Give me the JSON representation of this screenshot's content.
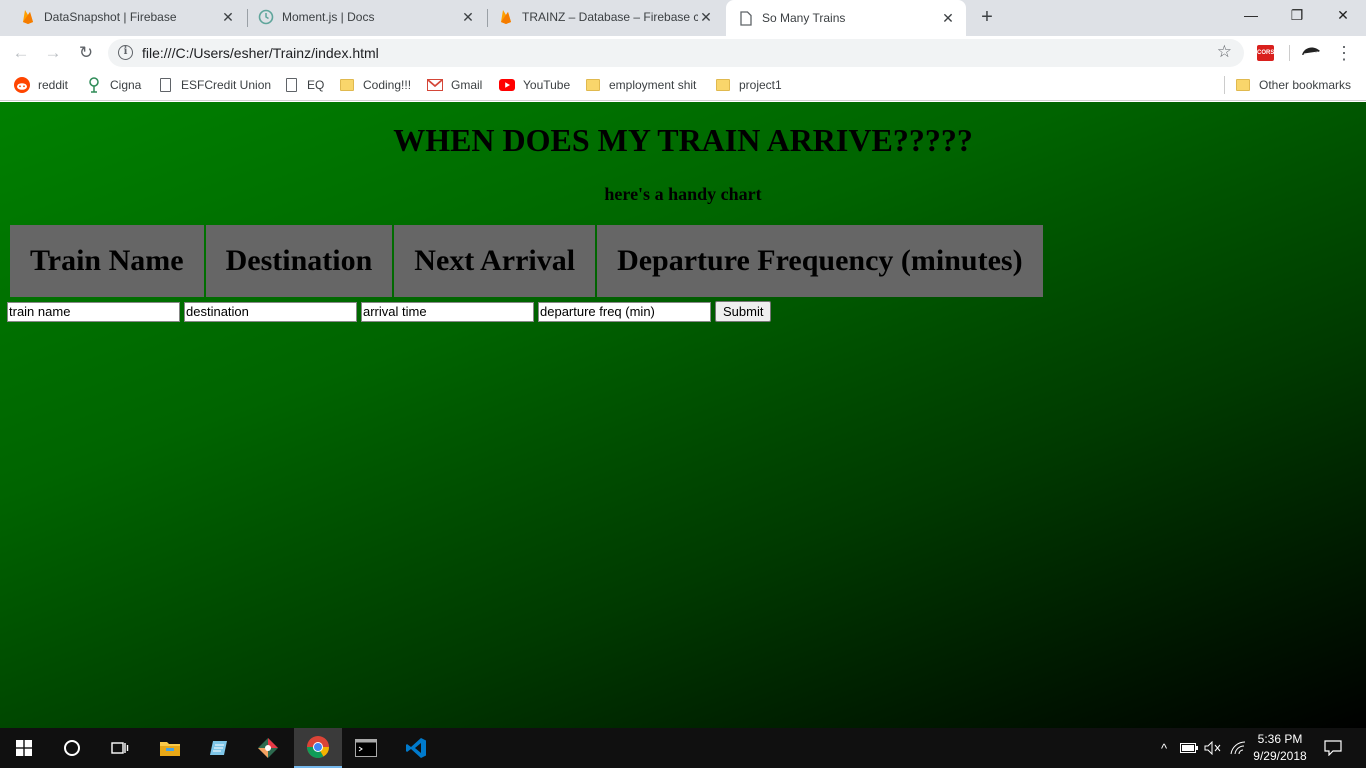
{
  "browser": {
    "tabs": [
      {
        "title": "DataSnapshot  |  Firebase",
        "icon": "firebase-icon",
        "active": false
      },
      {
        "title": "Moment.js | Docs",
        "icon": "clock-icon",
        "active": false
      },
      {
        "title": "TRAINZ – Database – Firebase co",
        "icon": "firebase-icon",
        "active": false
      },
      {
        "title": "So Many Trains",
        "icon": "page-icon",
        "active": true
      }
    ],
    "new_tab_label": "+",
    "window_controls": {
      "minimize": "—",
      "restore": "❐",
      "close": "✕"
    },
    "url": "file:///C:/Users/esher/Trainz/index.html",
    "ext_cors_label": "CORS"
  },
  "bookmarks": [
    {
      "label": "reddit",
      "icon": "reddit-icon"
    },
    {
      "label": "Cigna",
      "icon": "cigna-tree-icon"
    },
    {
      "label": "ESFCredit Union",
      "icon": "page-icon"
    },
    {
      "label": "EQ",
      "icon": "page-icon"
    },
    {
      "label": "Coding!!!",
      "icon": "folder-icon"
    },
    {
      "label": "Gmail",
      "icon": "gmail-icon"
    },
    {
      "label": "YouTube",
      "icon": "youtube-icon"
    },
    {
      "label": "employment shit",
      "icon": "folder-icon"
    },
    {
      "label": "project1",
      "icon": "folder-icon"
    }
  ],
  "other_bookmarks": "Other bookmarks",
  "page": {
    "title": "WHEN DOES MY TRAIN ARRIVE?????",
    "subtitle": "here's a handy chart",
    "table_headers": [
      "Train Name",
      "Destination",
      "Next Arrival",
      "Departure Frequency (minutes)"
    ],
    "form": {
      "train_name_placeholder": "train name",
      "destination_placeholder": "destination",
      "arrival_placeholder": "arrival time",
      "frequency_placeholder": "departure freq (min)",
      "submit_label": "Submit"
    },
    "background_colors": [
      "#008000",
      "#000000"
    ]
  },
  "taskbar": {
    "time": "5:36 PM",
    "date": "9/29/2018",
    "accent": "#76b9ed"
  }
}
